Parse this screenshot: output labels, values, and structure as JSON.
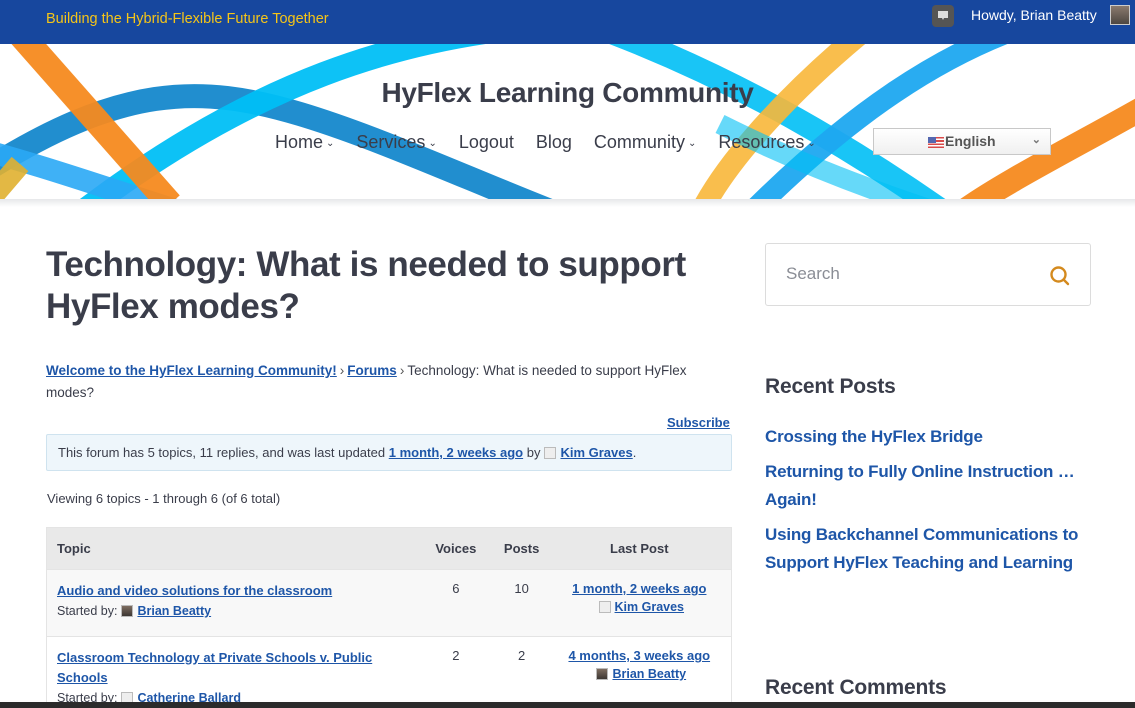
{
  "topbar": {
    "tagline": "Building the Hybrid-Flexible Future Together",
    "greeting": "Howdy, Brian Beatty",
    "icons": {
      "comment": "comment-bubble-icon",
      "avatar": "user-avatar"
    }
  },
  "header": {
    "site_title": "HyFlex Learning Community",
    "nav": [
      {
        "label": "Home",
        "has_dropdown": true
      },
      {
        "label": "Services",
        "has_dropdown": true
      },
      {
        "label": "Logout",
        "has_dropdown": false
      },
      {
        "label": "Blog",
        "has_dropdown": false
      },
      {
        "label": "Community",
        "has_dropdown": true
      },
      {
        "label": "Resources",
        "has_dropdown": true
      }
    ],
    "language": {
      "selected": "English",
      "flag": "us-flag-icon"
    }
  },
  "main": {
    "page_title": "Technology: What is needed to support HyFlex modes?",
    "breadcrumb": {
      "home": "Welcome to the HyFlex Learning Community!",
      "forums": "Forums",
      "current": "Technology: What is needed to support HyFlex modes?",
      "separator": "›"
    },
    "subscribe_label": "Subscribe",
    "notice": {
      "prefix": "This forum has 5 topics, 11 replies, and was last updated",
      "updated_link": "1 month, 2 weeks ago",
      "by": "by",
      "user": "Kim Graves",
      "suffix": "."
    },
    "viewing": "Viewing 6 topics - 1 through 6 (of 6 total)",
    "table": {
      "headers": {
        "topic": "Topic",
        "voices": "Voices",
        "posts": "Posts",
        "last_post": "Last Post"
      },
      "started_by_label": "Started by:",
      "rows": [
        {
          "title": "Audio and video solutions for the classroom",
          "started_by": "Brian Beatty",
          "voices": "6",
          "posts": "10",
          "last_post_time": "1 month, 2 weeks ago",
          "last_post_user": "Kim Graves"
        },
        {
          "title": "Classroom Technology at Private Schools v. Public Schools",
          "started_by": "Catherine Ballard",
          "voices": "2",
          "posts": "2",
          "last_post_time": "4 months, 3 weeks ago",
          "last_post_user": "Brian Beatty"
        }
      ]
    }
  },
  "sidebar": {
    "search_placeholder": "Search",
    "search_value": "",
    "recent_posts_title": "Recent Posts",
    "recent_posts": [
      "Crossing the HyFlex Bridge",
      "Returning to Fully Online Instruction … Again!",
      "Using Backchannel Communications to Support HyFlex Teaching and Learning"
    ],
    "recent_comments_title": "Recent Comments"
  },
  "colors": {
    "topbar_bg": "#17479e",
    "tagline": "#f5c518",
    "link": "#1e56a8",
    "text": "#3a3d4a",
    "search_icon": "#d48a1e",
    "notice_bg": "#eef6fb"
  }
}
